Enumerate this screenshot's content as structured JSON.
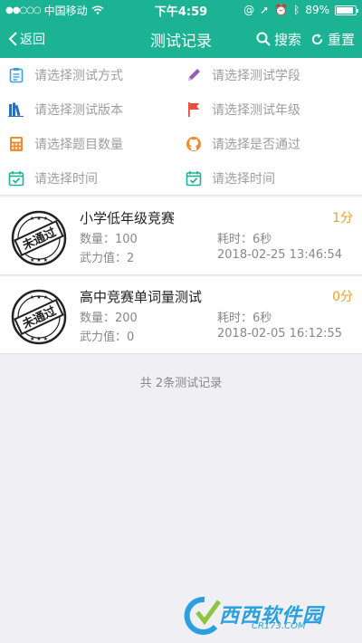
{
  "status_bar": {
    "carrier": "中国移动",
    "time": "下午4:59",
    "battery": "89%",
    "battery_level": 0.89
  },
  "navbar": {
    "back_label": "返回",
    "title": "测试记录",
    "search_label": "搜索",
    "reset_label": "重置"
  },
  "filters": [
    {
      "label": "请选择测试方式",
      "icon": "clipboard-icon",
      "color": "#3aa0e0"
    },
    {
      "label": "请选择测试学段",
      "icon": "pencil-icon",
      "color": "#9b59b6"
    },
    {
      "label": "请选择测试版本",
      "icon": "books-icon",
      "color": "#2c6fb5"
    },
    {
      "label": "请选择测试年级",
      "icon": "flag-icon",
      "color": "#e74c3c"
    },
    {
      "label": "请选择题目数量",
      "icon": "calculator-icon",
      "color": "#f08c30"
    },
    {
      "label": "请选择是否通过",
      "icon": "github-icon",
      "color": "#f08c30"
    },
    {
      "label": "请选择时间",
      "icon": "calendar-check-icon",
      "color": "#1bb393"
    },
    {
      "label": "请选择时间",
      "icon": "calendar-check-icon",
      "color": "#1bb393"
    }
  ],
  "records": [
    {
      "title": "小学低年级竞赛",
      "score": "1分",
      "count": "数量：100",
      "duration": "耗时：6秒",
      "power": "武力值：2",
      "datetime": "2018-02-25 13:46:54",
      "stamp_text": "未通过"
    },
    {
      "title": "高中竞赛单词量测试",
      "score": "0分",
      "count": "数量：200",
      "duration": "耗时：6秒",
      "power": "武力值：0",
      "datetime": "2018-02-05 16:12:55",
      "stamp_text": "未通过"
    }
  ],
  "footer": {
    "summary": "共 2条测试记录"
  },
  "watermark": {
    "brand": "西西软件园",
    "url": "CR173.COM"
  },
  "colors": {
    "accent": "#1bb393",
    "score": "#f0a020"
  }
}
